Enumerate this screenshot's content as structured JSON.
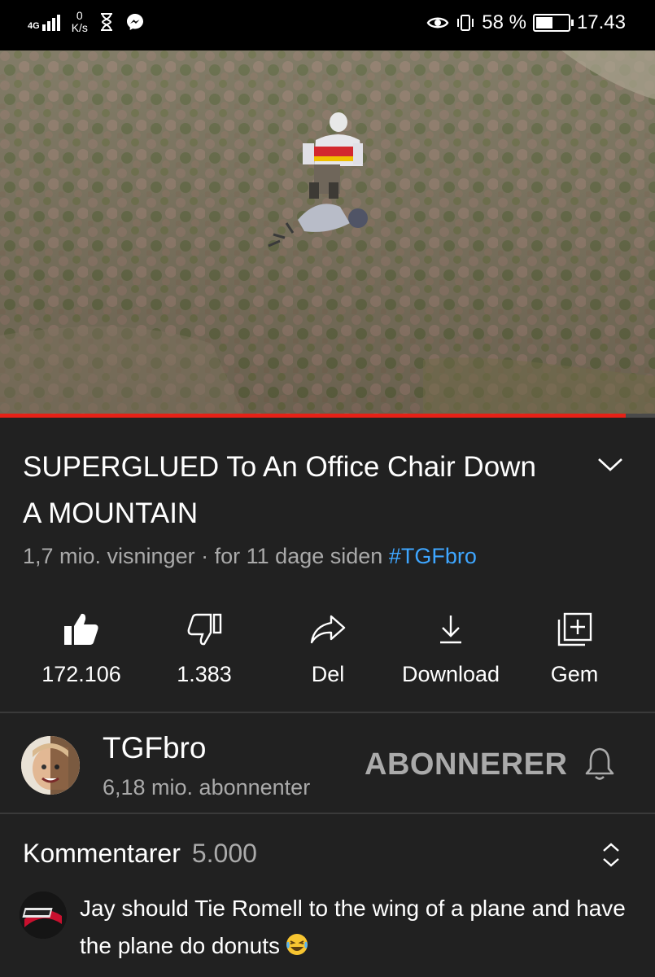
{
  "status_bar": {
    "network": "4G",
    "speed_value": "0",
    "speed_unit": "K/s",
    "battery": "58 %",
    "battery_level": 0.58,
    "time": "17.43"
  },
  "video": {
    "progress": 0.955
  },
  "details": {
    "title": "SUPERGLUED To An Office Chair Down A MOUNTAIN",
    "views": "1,7 mio. visninger",
    "separator": "·",
    "age": "for 11 dage siden",
    "hashtag": "#TGFbro"
  },
  "actions": [
    {
      "icon": "thumbs-up-icon",
      "label": "172.106"
    },
    {
      "icon": "thumbs-down-icon",
      "label": "1.383"
    },
    {
      "icon": "share-icon",
      "label": "Del"
    },
    {
      "icon": "download-icon",
      "label": "Download"
    },
    {
      "icon": "add-to-playlist-icon",
      "label": "Gem"
    }
  ],
  "channel": {
    "name": "TGFbro",
    "subscribers": "6,18 mio. abonnenter",
    "subscribe_label": "ABONNERER"
  },
  "comments": {
    "heading": "Kommentarer",
    "count": "5.000",
    "first_comment": "Jay should Tie Romell to the wing of a plane and have the plane do donuts"
  },
  "colors": {
    "background": "#212121",
    "progress": "#e62117",
    "hashtag": "#3ea6ff",
    "secondary_text": "#aaaaaa"
  }
}
